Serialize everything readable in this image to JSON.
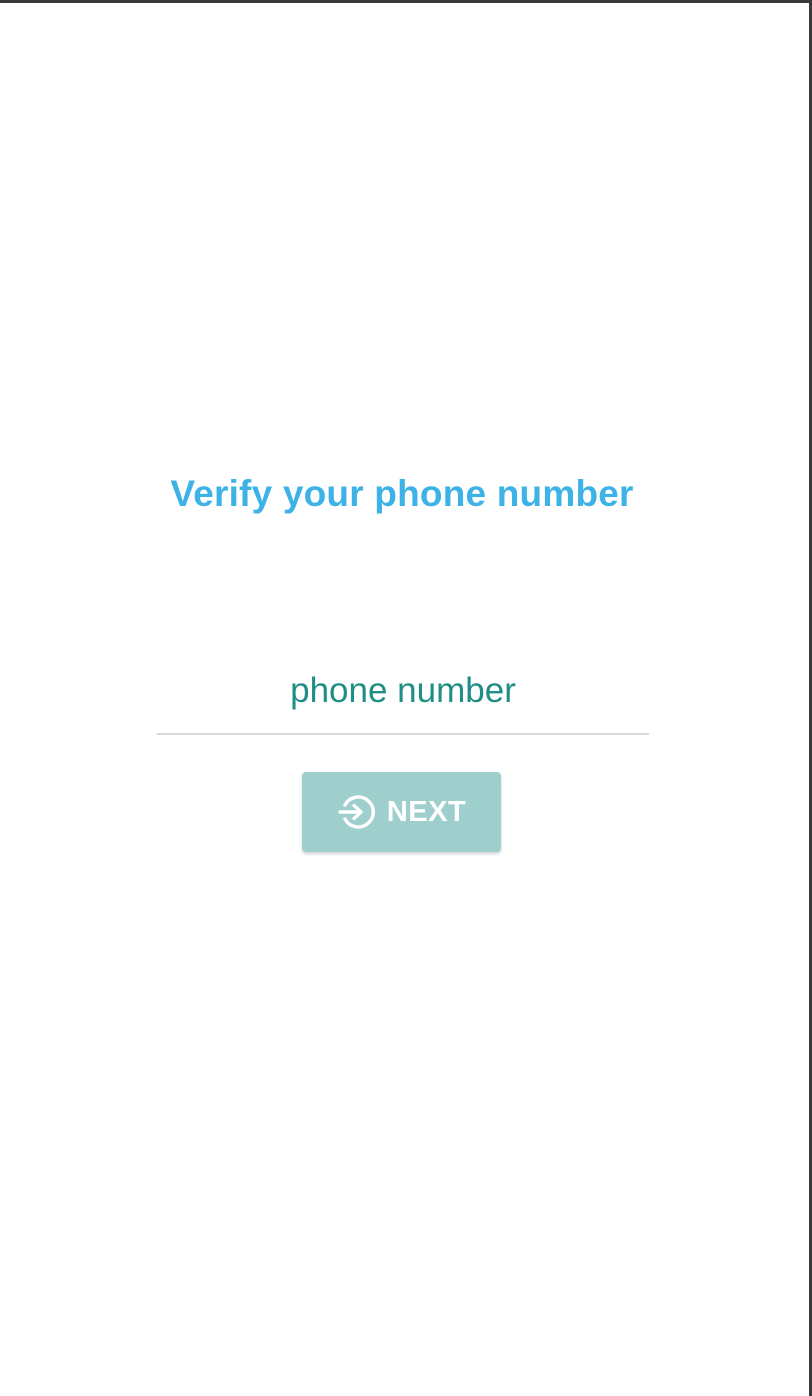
{
  "page": {
    "title": "Verify your phone number"
  },
  "phone": {
    "placeholder": "phone number",
    "value": ""
  },
  "actions": {
    "next_label": "NEXT",
    "next_icon": "login-arrow-icon"
  },
  "colors": {
    "title": "#3cb2e6",
    "input_text": "#1f8e84",
    "button_bg": "#9fcfcc",
    "button_text": "#ffffff",
    "underline": "#d9d9d9"
  }
}
